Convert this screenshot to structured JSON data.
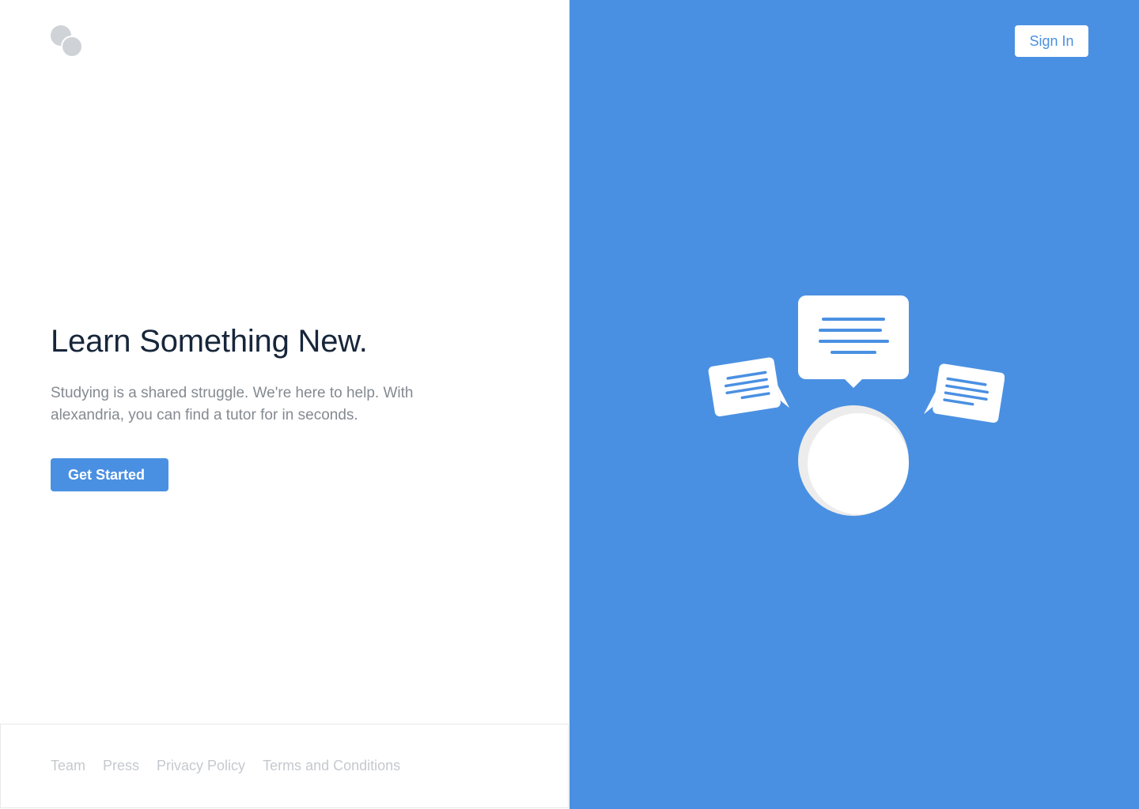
{
  "brand": {
    "logo_icon": "two-circles-logo-icon",
    "logo_color": "#cfd3d7"
  },
  "hero": {
    "headline": "Learn Something New.",
    "description": "Studying is a shared struggle. We're here to help. With alexandria, you can find a tutor for in seconds.",
    "cta_label": "Get Started"
  },
  "header": {
    "signin_label": "Sign In"
  },
  "footer": {
    "links": [
      {
        "label": "Team"
      },
      {
        "label": "Press"
      },
      {
        "label": "Privacy Policy"
      },
      {
        "label": "Terms and Conditions"
      }
    ]
  },
  "illustration": {
    "icon": "chat-bubbles-person-illustration",
    "accent_color": "#4a90e2"
  },
  "colors": {
    "brand_blue": "#4a90e2",
    "heading": "#17263a",
    "body_text": "#848a91",
    "footer_link": "#c5c9ce"
  }
}
